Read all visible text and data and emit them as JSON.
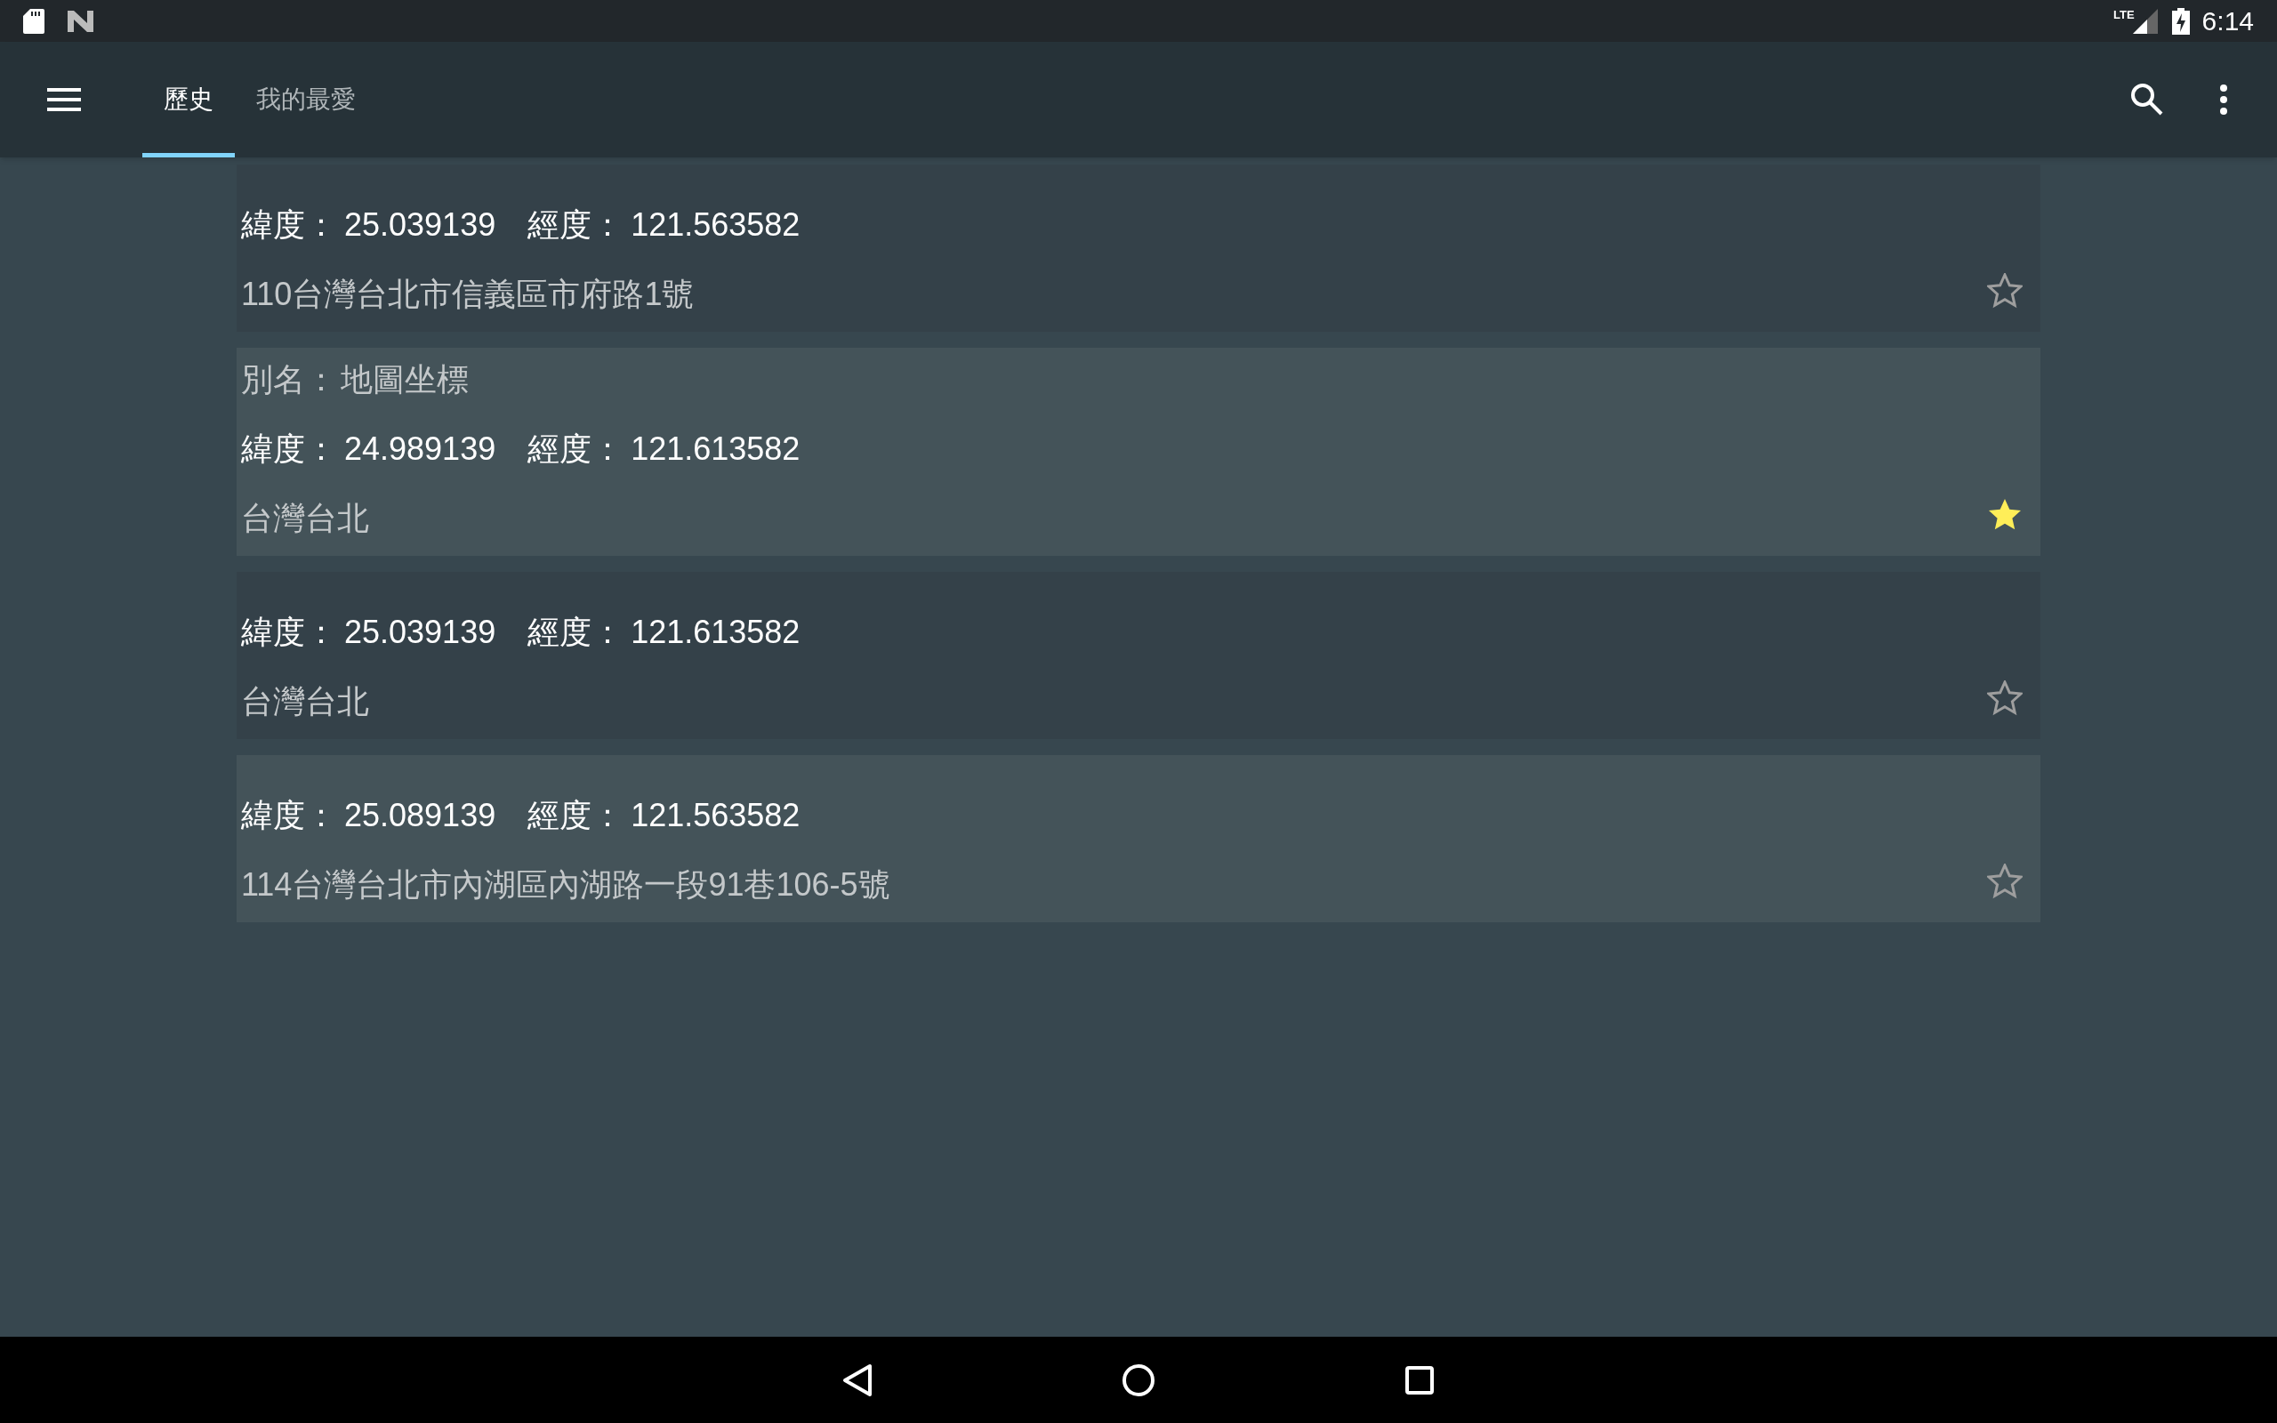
{
  "status_bar": {
    "network": "LTE",
    "time": "6:14"
  },
  "app_bar": {
    "tabs": [
      {
        "label": "歷史",
        "selected": true
      },
      {
        "label": "我的最愛",
        "selected": false
      }
    ]
  },
  "cards": [
    {
      "latitude_label": "緯度：",
      "latitude": "25.039139",
      "longitude_label": "經度：",
      "longitude": "121.563582",
      "address": "110台灣台北市信義區市府路1號",
      "favorite": false
    },
    {
      "alias_label": "別名：",
      "alias": "地圖坐標",
      "latitude_label": "緯度：",
      "latitude": "24.989139",
      "longitude_label": "經度：",
      "longitude": "121.613582",
      "address": "台灣台北",
      "favorite": true
    },
    {
      "latitude_label": "緯度：",
      "latitude": "25.039139",
      "longitude_label": "經度：",
      "longitude": "121.613582",
      "address": "台灣台北",
      "favorite": false
    },
    {
      "latitude_label": "緯度：",
      "latitude": "25.089139",
      "longitude_label": "經度：",
      "longitude": "121.563582",
      "address": "114台灣台北市內湖區內湖路一段91巷106-5號",
      "favorite": false
    }
  ]
}
